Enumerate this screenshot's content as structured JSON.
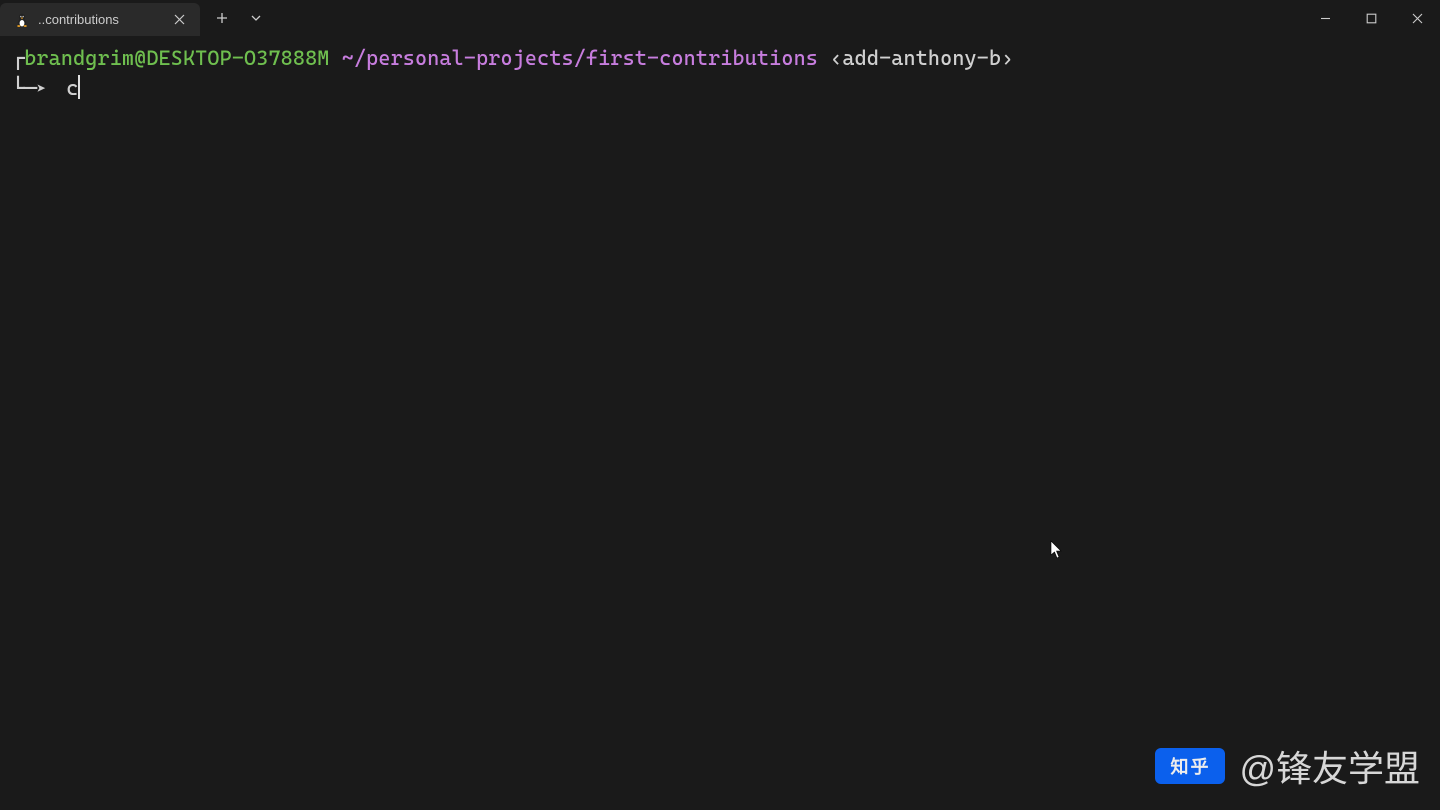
{
  "tab": {
    "title": "..contributions",
    "icon": "tux-icon"
  },
  "window_controls": {
    "minimize": "minimize",
    "maximize": "maximize",
    "close": "close"
  },
  "prompt": {
    "user_host": "brandgrim@DESKTOP-O37888M",
    "path": "~/personal-projects/first-contributions",
    "branch": "‹add-anthony-b›",
    "arrow": "➤",
    "input": "c"
  },
  "watermark": {
    "logo_text": "知乎",
    "text": "@锋友学盟"
  }
}
